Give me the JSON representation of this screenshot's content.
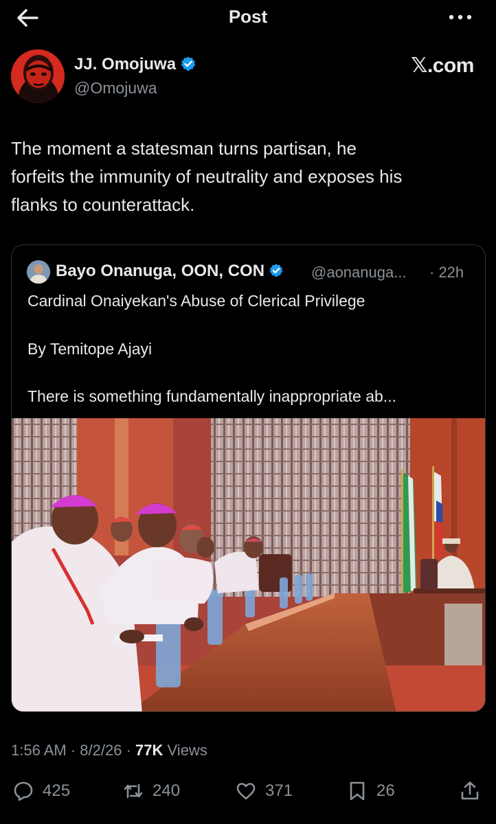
{
  "header": {
    "title": "Post",
    "back_icon": "arrow-left-icon",
    "more_icon": "more-horizontal-icon"
  },
  "author": {
    "name": "JJ. Omojuwa",
    "handle": "@Omojuwa",
    "verified": true,
    "verified_color": "#1d9bf0",
    "source": "𝕏.com"
  },
  "post": {
    "lines": [
      "The moment a statesman turns partisan, he",
      "forfeits the immunity of neutrality and exposes his",
      "flanks to counterattack."
    ]
  },
  "quoted": {
    "name": "Bayo Onanuga, OON, CON",
    "verified": true,
    "handle": "@aonanuga...",
    "time": "· 22h",
    "title": "Cardinal Onaiyekan's Abuse of Clerical Privilege",
    "byline": "By Temitope Ajayi",
    "excerpt": "There is something fundamentally inappropriate ab..."
  },
  "meta": {
    "time": "1:56 AM",
    "date": "8/2/26",
    "sep": "·",
    "views_count": "77K",
    "views_label": "Views"
  },
  "actions": {
    "replies": "425",
    "reposts": "240",
    "likes": "371",
    "bookmarks": "26"
  },
  "colors": {
    "background": "#000000",
    "text": "#e7e9ea",
    "muted": "#8b9299",
    "border": "#2f3336",
    "accent": "#1d9bf0"
  }
}
